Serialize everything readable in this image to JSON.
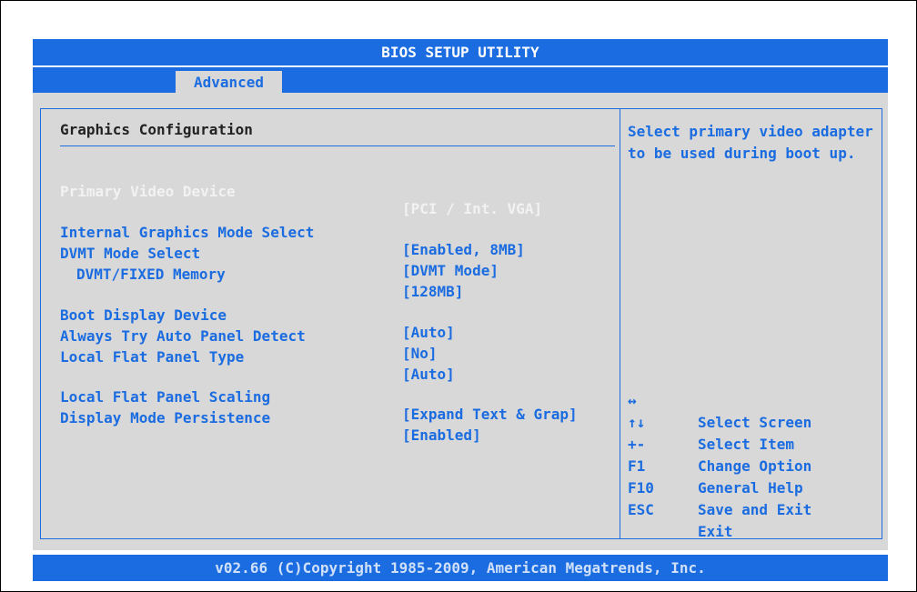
{
  "title": "BIOS SETUP UTILITY",
  "active_tab": "Advanced",
  "section_title": "Graphics Configuration",
  "settings": [
    {
      "label": "Primary Video Device",
      "value": "[PCI / Int. VGA]"
    },
    {
      "label": "Internal Graphics Mode Select",
      "value": "[Enabled, 8MB]"
    },
    {
      "label": "DVMT Mode Select",
      "value": "[DVMT Mode]"
    },
    {
      "label": "DVMT/FIXED Memory",
      "value": "[128MB]"
    },
    {
      "label": "Boot Display Device",
      "value": "[Auto]"
    },
    {
      "label": "Always Try Auto Panel Detect",
      "value": "[No]"
    },
    {
      "label": "Local Flat Panel Type",
      "value": "[Auto]"
    },
    {
      "label": "Local Flat Panel Scaling",
      "value": "[Expand Text & Grap]"
    },
    {
      "label": "Display Mode Persistence",
      "value": "[Enabled]"
    }
  ],
  "help_text": "Select primary video adapter to be used during boot up.",
  "keys": [
    {
      "key": "↔",
      "desc": "Select Screen"
    },
    {
      "key": "↑↓",
      "desc": "Select Item"
    },
    {
      "key": "+-",
      "desc": "Change Option"
    },
    {
      "key": "F1",
      "desc": "General Help"
    },
    {
      "key": "F10",
      "desc": "Save and Exit"
    },
    {
      "key": "ESC",
      "desc": "Exit"
    }
  ],
  "footer": "v02.66 (C)Copyright 1985-2009, American Megatrends, Inc.",
  "colors": {
    "accent_blue": "#1a6ce0",
    "panel_gray": "#d8d8d8",
    "disabled_text": "#f2f2f2"
  }
}
